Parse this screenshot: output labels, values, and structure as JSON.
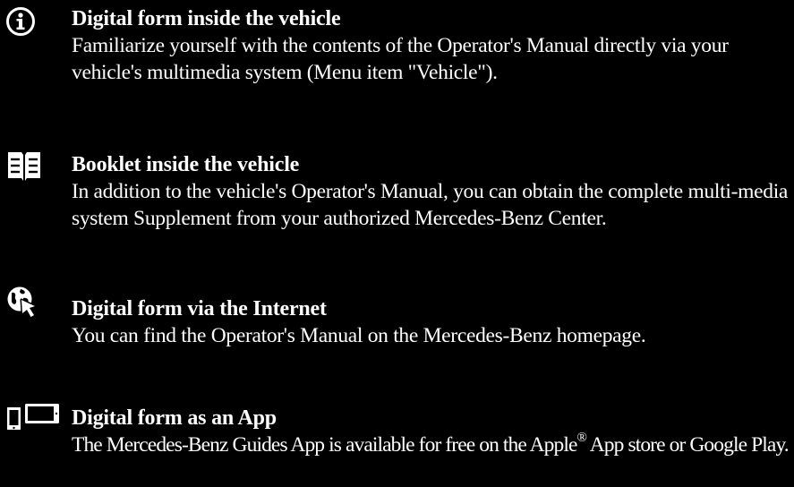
{
  "sections": [
    {
      "icon": "info-circle-icon",
      "title": "Digital form inside the vehicle",
      "body": "Familiarize yourself with the contents of the Operator's Manual directly via your vehicle's multimedia system (Menu item \"Vehicle\")."
    },
    {
      "icon": "open-book-icon",
      "title": "Booklet inside the vehicle",
      "body": "In addition to the vehicle's Operator's Manual, you can obtain the complete multi-media system Supplement from your authorized Mercedes-Benz Center."
    },
    {
      "icon": "globe-cursor-icon",
      "title": "Digital form via the Internet",
      "body": "You can find the Operator's Manual on the Mercedes-Benz homepage."
    },
    {
      "icon": "phone-tablet-icon",
      "title": "Digital form as an App",
      "body_pre": "The Mercedes-Benz Guides App is available for free on the Apple",
      "body_sup": "®",
      "body_post": " App store or Google Play."
    }
  ]
}
